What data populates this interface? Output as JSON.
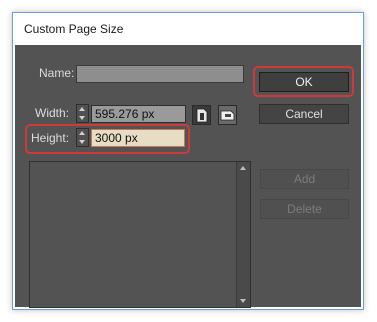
{
  "window": {
    "title": "Custom Page Size"
  },
  "form": {
    "name_label": "Name:",
    "name_value": "",
    "width_label": "Width:",
    "width_value": "595.276 px",
    "height_label": "Height:",
    "height_value": "3000 px"
  },
  "buttons": {
    "ok": "OK",
    "cancel": "Cancel",
    "add": "Add",
    "delete": "Delete"
  },
  "list": {
    "items": []
  },
  "colors": {
    "dialog_bg": "#535353",
    "highlight": "#d0393a"
  }
}
